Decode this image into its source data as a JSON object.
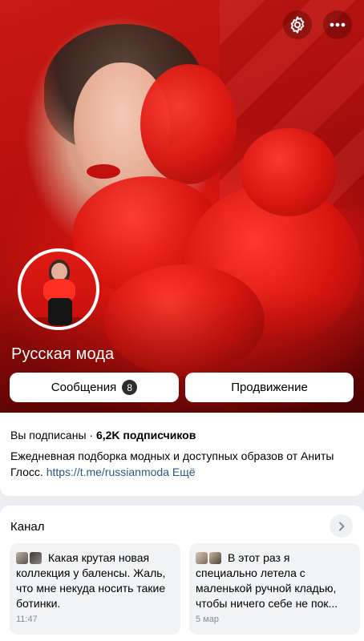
{
  "header": {
    "settings_icon": "gear-icon",
    "more_icon": "more-horizontal-icon"
  },
  "community": {
    "name": "Русская мода"
  },
  "actions": {
    "messages_label": "Сообщения",
    "messages_count": "8",
    "promotion_label": "Продвижение"
  },
  "info": {
    "subscribed_text": "Вы подписаны · ",
    "subscribers_text": "6,2K подписчиков",
    "description": "Ежедневная подборка модных и доступных образов от Аниты Глосс. ",
    "link": "https://t.me/russianmoda",
    "more_label": "Ещё"
  },
  "channel": {
    "title": "Канал",
    "arrow_icon": "chevron-right-icon",
    "posts": [
      {
        "text": "Какая крутая новая коллекция у баленсы. Жаль, что мне некуда носить такие ботинки.",
        "time": "11:47"
      },
      {
        "text": "В этот раз я специально летела с маленькой ручной кладью, чтобы ничего себе не пок...",
        "time": "5 мар"
      }
    ]
  },
  "colors": {
    "hero_red": "#c91a14",
    "link": "#2a5885",
    "badge": "#2c2d2e",
    "muted": "#818c99"
  }
}
